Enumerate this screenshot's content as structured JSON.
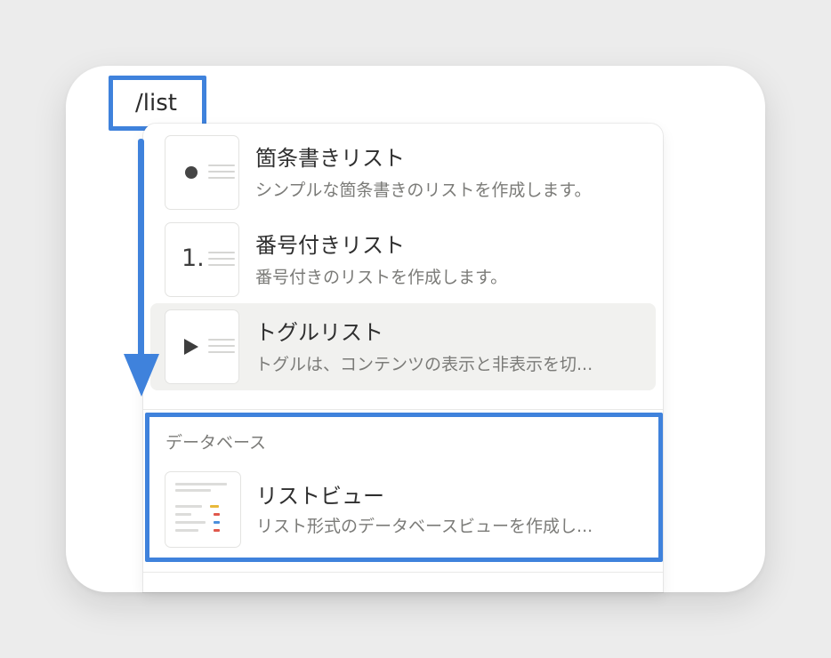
{
  "query": "/list",
  "items": [
    {
      "title": "箇条書きリスト",
      "description": "シンプルな箇条書きのリストを作成します。",
      "thumb_icon": "bullet-icon"
    },
    {
      "title": "番号付きリスト",
      "description": "番号付きのリストを作成します。",
      "thumb_icon": "numbered-icon",
      "thumb_glyph": "1."
    },
    {
      "title": "トグルリスト",
      "description": "トグルは、コンテンツの表示と非表示を切...",
      "thumb_icon": "toggle-icon",
      "selected": true
    }
  ],
  "database_section": {
    "label": "データベース",
    "items": [
      {
        "title": "リストビュー",
        "description": "リスト形式のデータベースビューを作成し...",
        "thumb_icon": "list-view-icon"
      }
    ]
  },
  "colors": {
    "highlight": "#3f82dc",
    "selected_row": "#f1f1ef",
    "tag_yellow": "#e8b93a",
    "tag_red": "#e0584c",
    "tag_blue": "#4a8fdc"
  }
}
